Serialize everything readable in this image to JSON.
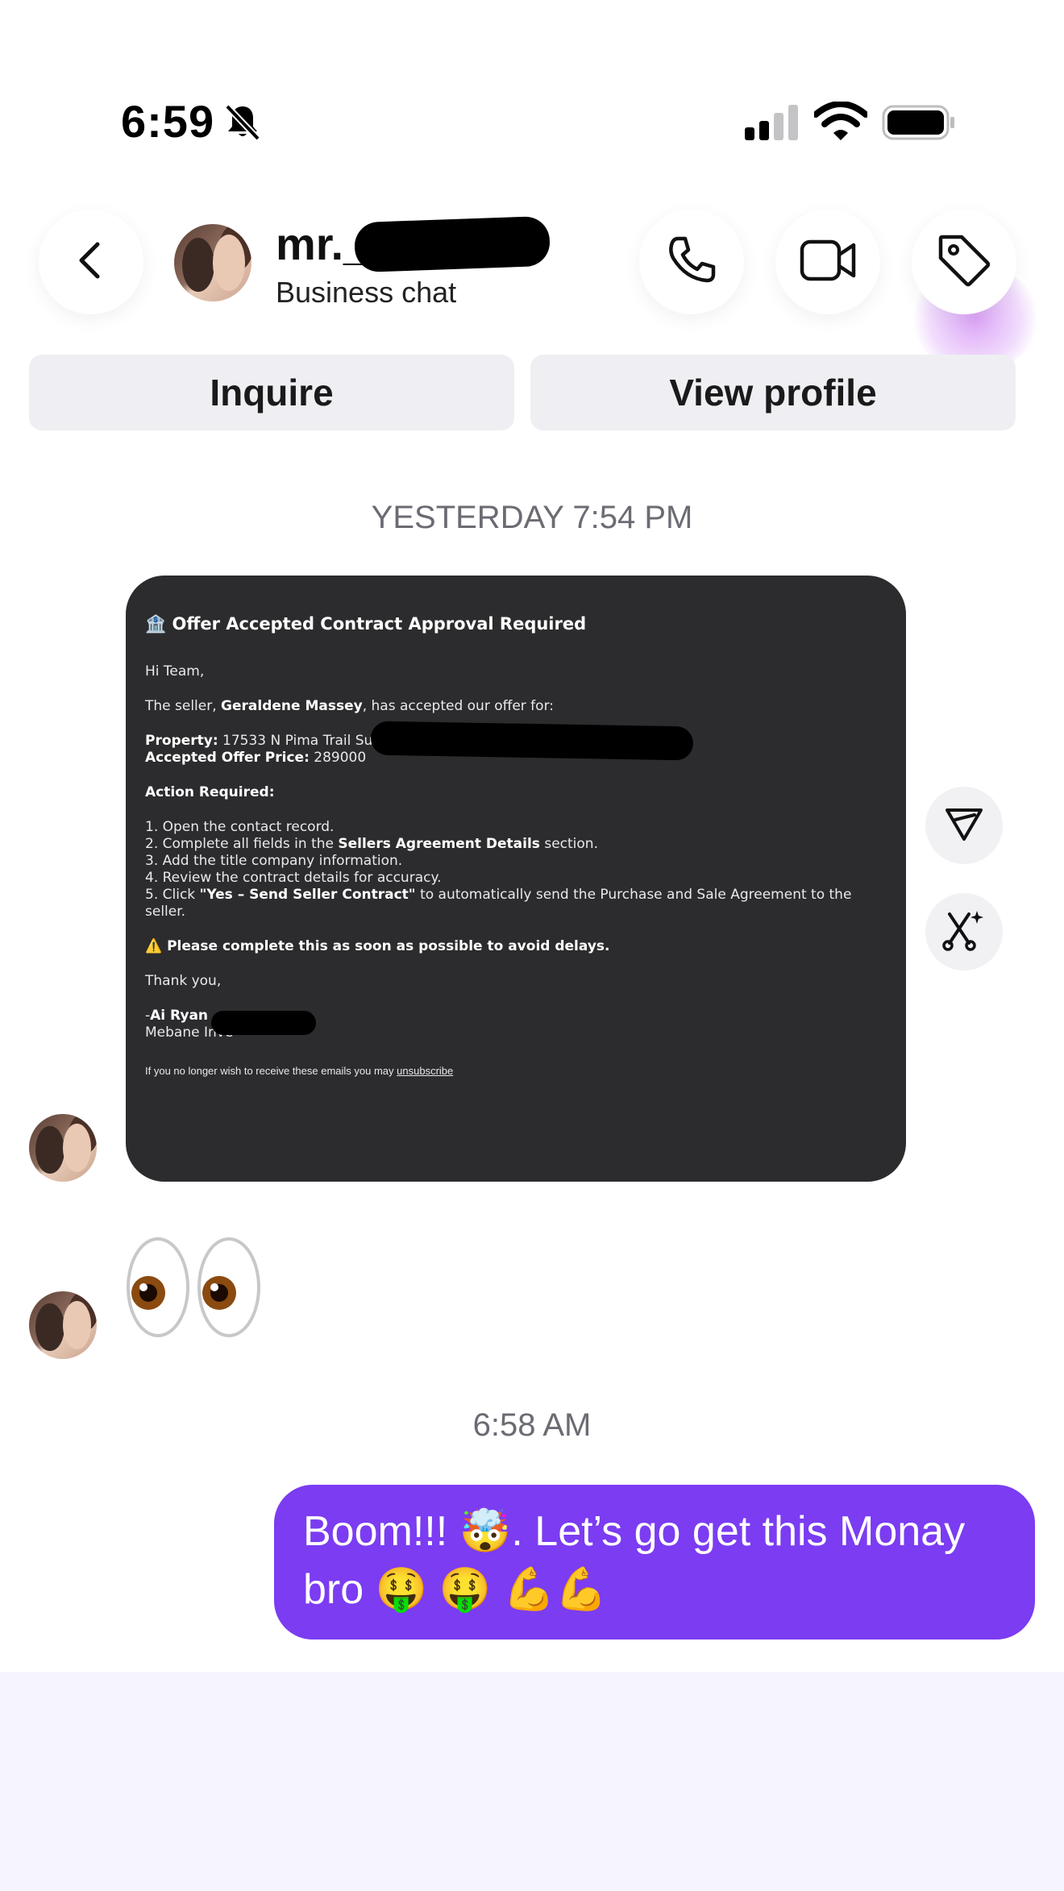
{
  "status_bar": {
    "time": "6:59",
    "icons": [
      "bell-slash-icon",
      "cellular-signal-icon",
      "wifi-icon",
      "battery-icon"
    ]
  },
  "header": {
    "contact_name": "mr._",
    "contact_subtitle": "Business chat",
    "icons": [
      "back-arrow-icon",
      "phone-icon",
      "video-camera-icon",
      "tag-icon"
    ]
  },
  "action_bar": {
    "inquire_label": "Inquire",
    "view_profile_label": "View profile"
  },
  "chat": {
    "timestamp_1": "YESTERDAY 7:54 PM",
    "timestamp_2": "6:58 AM",
    "email_card": {
      "title_emoji": "🏦",
      "title": "Offer Accepted Contract Approval Required",
      "greeting": "Hi Team,",
      "seller_prefix": "The seller, ",
      "seller_name": "Geraldene Massey",
      "seller_suffix": ", has accepted our offer for:",
      "property_label": "Property:",
      "property_value": "17533 N Pima Trail Sur",
      "price_label": "Accepted Offer Price:",
      "price_value": "289000",
      "action_heading": "Action Required:",
      "step1": "1. Open the contact record.",
      "step2_prefix": "2. Complete all fields in the ",
      "step2_bold": "Sellers Agreement Details",
      "step2_suffix": " section.",
      "step3": "3. Add the title company information.",
      "step4": "4. Review the contract details for accuracy.",
      "step5_prefix": "5. Click ",
      "step5_bold": "\"Yes – Send Seller Contract\"",
      "step5_suffix": " to automatically send the Purchase and Sale Agreement to the seller.",
      "warning_icon": "⚠️",
      "warning": "Please complete this as soon as possible to avoid delays.",
      "thanks": "Thank you,",
      "sig_prefix": "-",
      "sig_name": "Ai Ryan",
      "sig_company": "Mebane Inve",
      "unsub_text": "If you no longer wish to receive these emails you may ",
      "unsub_link": "unsubscribe"
    },
    "side_buttons": [
      "share-icon",
      "ai-sparkle-icon"
    ],
    "eyes_emoji": "👀",
    "sent_message": "Boom!!! 🤯. Let’s go get this Monay bro 🤑 🤑 💪💪"
  },
  "colors": {
    "sent_bubble": "#7b3cf2",
    "pill_bg": "#efeff3",
    "card_bg": "#2c2c2e",
    "timestamp": "#6b6b73"
  }
}
